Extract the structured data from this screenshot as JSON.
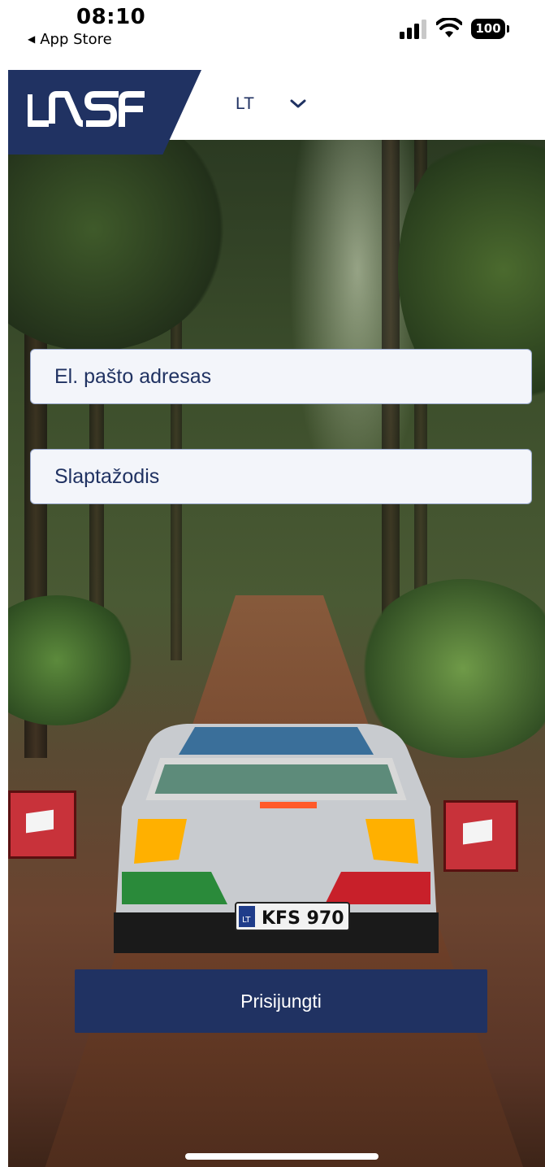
{
  "status_bar": {
    "time": "08:10",
    "back_label": "App Store",
    "battery": "100"
  },
  "header": {
    "logo_text": "LASF",
    "language": "LT"
  },
  "form": {
    "email_placeholder": "El. pašto adresas",
    "password_placeholder": "Slaptažodis",
    "login_label": "Prisijungti"
  },
  "background": {
    "plate_text": "KFS 970",
    "plate_country": "LT"
  },
  "colors": {
    "brand": "#203262",
    "input_bg": "#f3f5fa",
    "input_border": "#9aa9cd"
  }
}
